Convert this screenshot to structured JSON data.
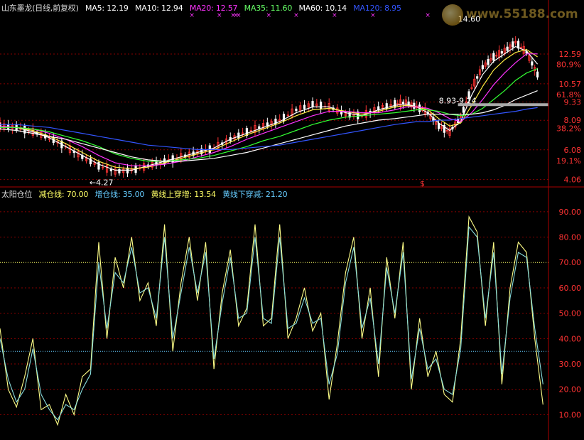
{
  "top_header": {
    "title": "山东墨龙(日线,前复权)",
    "items": [
      {
        "label": "MA5: 12.19",
        "color": "#ffffff"
      },
      {
        "label": "MA10: 12.94",
        "color": "#ffffff"
      },
      {
        "label": "MA20: 12.57",
        "color": "#ff33ff"
      },
      {
        "label": "MA35: 11.60",
        "color": "#66ff66"
      },
      {
        "label": "MA60: 10.14",
        "color": "#ffffff"
      },
      {
        "label": "MA120: 8.95",
        "color": "#3355ff"
      }
    ]
  },
  "watermark": {
    "text": "www.55188.com"
  },
  "bottom_header": {
    "title": "太阳仓位",
    "items": [
      {
        "label": "减仓线: 70.00",
        "color": "#ffff66"
      },
      {
        "label": "增仓线: 35.00",
        "color": "#66ccff"
      },
      {
        "label": "黄线上穿增: 13.54",
        "color": "#ffff66"
      },
      {
        "label": "黄线下穿减: 21.20",
        "color": "#66ccff"
      }
    ]
  },
  "colors": {
    "background": "#000000",
    "axis_text": "#ff3333",
    "grid": "#880000",
    "yellow_line": "#ffff88",
    "cyan_line": "#88dddd",
    "up_candle": "#ff3333",
    "down_candle": "#ffffff",
    "ma5": "#ffffff",
    "ma10": "#ffee44",
    "ma20": "#ff33ff",
    "ma35": "#33ff33",
    "ma60": "#ffffff",
    "ma120": "#3355ff"
  },
  "chart_data": [
    {
      "type": "line",
      "panel": "price",
      "y_ticks": [
        "12.59",
        "10.57",
        "9.33",
        "8.09",
        "6.08",
        "4.06"
      ],
      "pct_ticks": [
        "80.9%",
        "61.8%",
        "38.2%",
        "19.1%"
      ],
      "ylim": [
        3.8,
        15.2
      ],
      "annotations": [
        {
          "text": "14.60",
          "x": 0.835,
          "value": 14.6
        },
        {
          "text": "←4.27",
          "x": 0.163,
          "value": 4.27
        },
        {
          "text": "8.93-9.24",
          "x": 0.8,
          "value": 9.05
        }
      ],
      "signal_marker": "$",
      "x": [
        0.0,
        0.03,
        0.06,
        0.09,
        0.12,
        0.15,
        0.18,
        0.21,
        0.24,
        0.27,
        0.3,
        0.33,
        0.36,
        0.39,
        0.42,
        0.45,
        0.48,
        0.51,
        0.54,
        0.57,
        0.6,
        0.63,
        0.66,
        0.69,
        0.72,
        0.74,
        0.76,
        0.78,
        0.8,
        0.82,
        0.84,
        0.86,
        0.88,
        0.9,
        0.92,
        0.94,
        0.96,
        0.98
      ],
      "close": [
        7.7,
        7.6,
        7.3,
        6.9,
        6.3,
        5.6,
        5.0,
        4.6,
        4.7,
        5.0,
        5.3,
        5.6,
        5.9,
        6.2,
        6.8,
        7.3,
        7.7,
        8.1,
        8.8,
        9.2,
        9.0,
        8.5,
        8.4,
        8.9,
        9.2,
        9.3,
        9.0,
        8.6,
        7.7,
        7.3,
        8.3,
        10.3,
        11.7,
        12.4,
        12.8,
        13.4,
        12.7,
        11.2
      ],
      "series": [
        {
          "name": "MA5",
          "color": "#ffffff",
          "values": [
            7.7,
            7.6,
            7.3,
            6.9,
            6.3,
            5.7,
            5.1,
            4.7,
            4.7,
            5.0,
            5.3,
            5.6,
            5.9,
            6.2,
            6.8,
            7.2,
            7.6,
            8.0,
            8.6,
            9.0,
            9.0,
            8.6,
            8.4,
            8.8,
            9.1,
            9.2,
            9.0,
            8.6,
            7.9,
            7.4,
            8.0,
            9.8,
            11.2,
            12.1,
            12.6,
            13.1,
            12.8,
            11.9
          ]
        },
        {
          "name": "MA10",
          "color": "#ffee44",
          "values": [
            7.7,
            7.6,
            7.4,
            7.0,
            6.5,
            5.9,
            5.3,
            4.9,
            4.8,
            4.9,
            5.2,
            5.5,
            5.8,
            6.1,
            6.6,
            7.1,
            7.5,
            7.9,
            8.4,
            8.8,
            8.9,
            8.7,
            8.5,
            8.7,
            9.0,
            9.1,
            9.0,
            8.8,
            8.2,
            7.7,
            7.9,
            9.1,
            10.4,
            11.5,
            12.2,
            12.7,
            12.9,
            12.4
          ]
        },
        {
          "name": "MA20",
          "color": "#ff33ff",
          "values": [
            7.7,
            7.6,
            7.5,
            7.2,
            6.8,
            6.3,
            5.7,
            5.2,
            5.0,
            5.0,
            5.1,
            5.3,
            5.6,
            5.9,
            6.3,
            6.8,
            7.2,
            7.6,
            8.0,
            8.4,
            8.7,
            8.7,
            8.6,
            8.6,
            8.8,
            9.0,
            9.0,
            8.9,
            8.6,
            8.2,
            8.0,
            8.6,
            9.5,
            10.5,
            11.3,
            12.0,
            12.6,
            12.6
          ]
        },
        {
          "name": "MA35",
          "color": "#33ff33",
          "values": [
            7.6,
            7.6,
            7.5,
            7.3,
            7.0,
            6.7,
            6.3,
            5.8,
            5.5,
            5.3,
            5.3,
            5.4,
            5.5,
            5.7,
            6.0,
            6.3,
            6.7,
            7.0,
            7.4,
            7.8,
            8.1,
            8.3,
            8.4,
            8.5,
            8.6,
            8.7,
            8.8,
            8.8,
            8.7,
            8.5,
            8.4,
            8.5,
            8.9,
            9.5,
            10.1,
            10.8,
            11.3,
            11.6
          ]
        },
        {
          "name": "MA60",
          "color": "#ffffff",
          "values": [
            7.5,
            7.4,
            7.2,
            7.0,
            6.8,
            6.5,
            6.2,
            5.9,
            5.6,
            5.4,
            5.3,
            5.3,
            5.4,
            5.5,
            5.7,
            5.9,
            6.2,
            6.5,
            6.8,
            7.1,
            7.4,
            7.7,
            7.9,
            8.1,
            8.2,
            8.3,
            8.4,
            8.5,
            8.5,
            8.5,
            8.5,
            8.5,
            8.6,
            8.8,
            9.1,
            9.5,
            9.8,
            10.1
          ]
        },
        {
          "name": "MA120",
          "color": "#3355ff",
          "values": [
            7.8,
            7.8,
            7.7,
            7.6,
            7.4,
            7.2,
            7.0,
            6.8,
            6.6,
            6.4,
            6.3,
            6.2,
            6.1,
            6.1,
            6.1,
            6.2,
            6.3,
            6.4,
            6.6,
            6.8,
            7.0,
            7.2,
            7.4,
            7.6,
            7.8,
            7.9,
            8.0,
            8.0,
            8.1,
            8.1,
            8.2,
            8.3,
            8.4,
            8.5,
            8.6,
            8.7,
            8.85,
            8.95
          ]
        }
      ]
    },
    {
      "type": "line",
      "panel": "indicator",
      "y_ticks": [
        "90.00",
        "80.00",
        "70.00",
        "60.00",
        "50.00",
        "40.00",
        "30.00",
        "20.00",
        "10.00"
      ],
      "ylim": [
        2,
        95
      ],
      "reference_lines": [
        {
          "value": 70,
          "color": "#ffff66"
        },
        {
          "value": 35,
          "color": "#66ccff"
        }
      ],
      "x": [
        0.0,
        0.015,
        0.03,
        0.045,
        0.06,
        0.075,
        0.09,
        0.105,
        0.12,
        0.135,
        0.15,
        0.165,
        0.18,
        0.195,
        0.21,
        0.225,
        0.24,
        0.255,
        0.27,
        0.285,
        0.3,
        0.315,
        0.33,
        0.345,
        0.36,
        0.375,
        0.39,
        0.405,
        0.42,
        0.435,
        0.45,
        0.465,
        0.48,
        0.495,
        0.51,
        0.525,
        0.54,
        0.555,
        0.57,
        0.585,
        0.6,
        0.615,
        0.63,
        0.645,
        0.66,
        0.675,
        0.69,
        0.705,
        0.72,
        0.735,
        0.75,
        0.765,
        0.78,
        0.795,
        0.81,
        0.825,
        0.84,
        0.855,
        0.87,
        0.885,
        0.9,
        0.915,
        0.93,
        0.945,
        0.96,
        0.975,
        0.99
      ],
      "series": [
        {
          "name": "",
          "color": "#ffff88",
          "values": [
            44,
            20,
            13,
            25,
            40,
            12,
            14,
            6,
            18,
            10,
            25,
            28,
            78,
            40,
            72,
            60,
            80,
            55,
            62,
            45,
            85,
            35,
            62,
            80,
            55,
            78,
            28,
            58,
            75,
            45,
            52,
            85,
            45,
            48,
            85,
            40,
            48,
            60,
            43,
            50,
            16,
            38,
            66,
            80,
            40,
            60,
            25,
            72,
            48,
            78,
            20,
            48,
            25,
            35,
            18,
            15,
            40,
            88,
            82,
            45,
            78,
            22,
            60,
            78,
            74,
            40,
            14
          ]
        },
        {
          "name": "",
          "color": "#88dddd",
          "values": [
            40,
            24,
            15,
            20,
            36,
            18,
            12,
            8,
            14,
            12,
            20,
            26,
            70,
            44,
            66,
            62,
            76,
            58,
            60,
            48,
            80,
            40,
            58,
            76,
            58,
            74,
            32,
            54,
            72,
            48,
            50,
            80,
            48,
            46,
            80,
            44,
            46,
            56,
            46,
            48,
            22,
            34,
            62,
            76,
            44,
            56,
            30,
            68,
            50,
            74,
            24,
            44,
            28,
            32,
            20,
            18,
            36,
            84,
            80,
            48,
            74,
            26,
            56,
            74,
            72,
            44,
            22
          ]
        }
      ]
    }
  ]
}
